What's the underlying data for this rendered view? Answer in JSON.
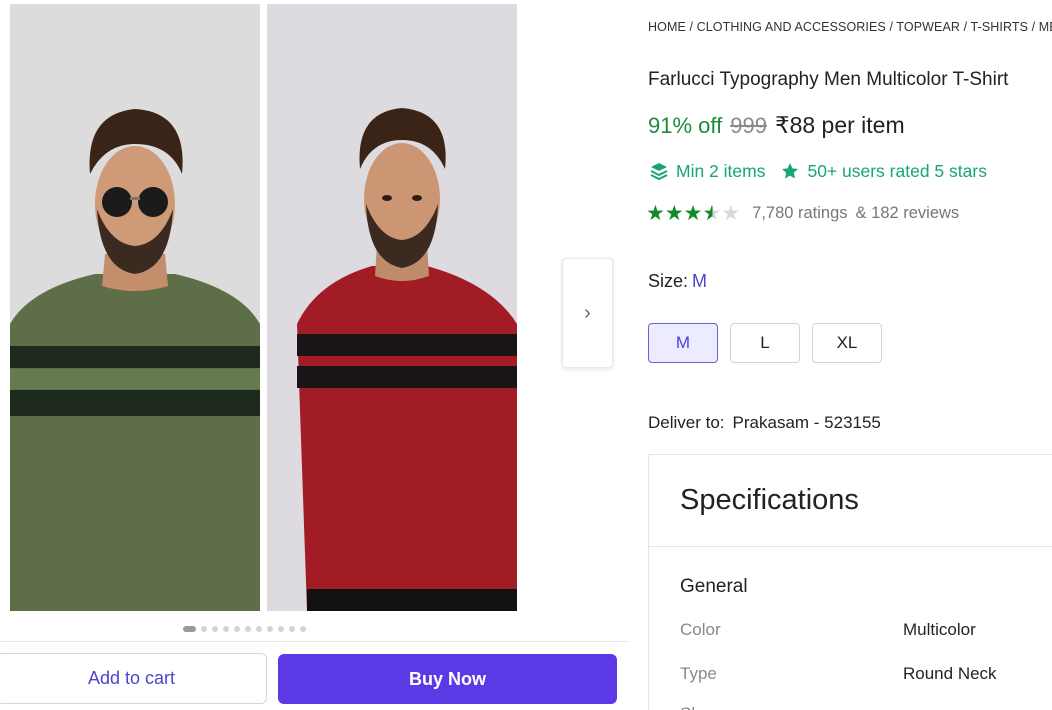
{
  "gallery": {
    "images": [
      {
        "alt": "green-striped-tshirt-model"
      },
      {
        "alt": "red-striped-tshirt-model"
      }
    ],
    "next_icon": "chevron-right-icon",
    "dot_count": 11,
    "active_dot": 0
  },
  "actions": {
    "add_to_cart": "Add to cart",
    "buy_now": "Buy Now"
  },
  "breadcrumb": "HOME / CLOTHING AND ACCESSORIES / TOPWEAR / T-SHIRTS / ME",
  "product": {
    "title": "Farlucci Typography Men Multicolor T-Shirt",
    "discount": "91% off",
    "mrp": "999",
    "price": "₹88 per item",
    "min_items": "Min 2 items",
    "users_rated": "50+ users rated 5 stars",
    "rating_value": 3.5,
    "ratings_count": "7,780 ratings",
    "reviews_count": "& 182 reviews"
  },
  "size": {
    "label": "Size:",
    "selected": "M",
    "options": [
      "M",
      "L",
      "XL"
    ]
  },
  "delivery": {
    "label": "Deliver to:",
    "location": "Prakasam - 523155"
  },
  "specifications": {
    "title": "Specifications",
    "group": "General",
    "rows": [
      {
        "key": "Color",
        "value": "Multicolor"
      },
      {
        "key": "Type",
        "value": "Round Neck"
      },
      {
        "key": "Sl",
        "value": ""
      }
    ]
  },
  "colors": {
    "accent": "#5b3ae6",
    "discount": "#1f8a3b",
    "badge": "#17a673",
    "star": "#118a2a"
  }
}
